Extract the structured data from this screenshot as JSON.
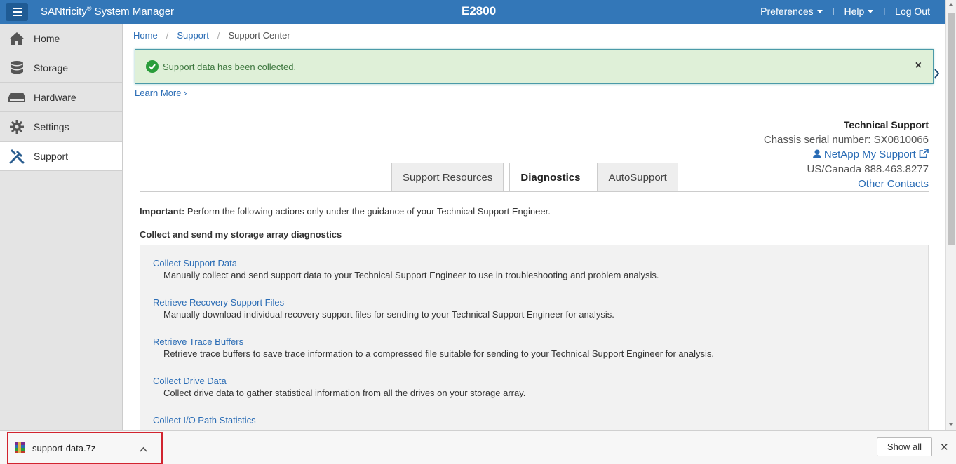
{
  "header": {
    "app_title_prefix": "SANtricity",
    "app_title_reg": "®",
    "app_title_suffix": " System Manager",
    "system_name": "E2800",
    "preferences": "Preferences",
    "help": "Help",
    "logout": "Log Out",
    "separator": "|"
  },
  "sidebar": {
    "items": [
      {
        "label": "Home",
        "icon": "home-icon"
      },
      {
        "label": "Storage",
        "icon": "database-icon"
      },
      {
        "label": "Hardware",
        "icon": "hardware-icon"
      },
      {
        "label": "Settings",
        "icon": "gear-icon"
      },
      {
        "label": "Support",
        "icon": "tools-icon",
        "active": true
      }
    ]
  },
  "breadcrumb": [
    "Home",
    "Support",
    "Support Center"
  ],
  "breadcrumb_sep": "/",
  "alert": {
    "message": "Support data has been collected.",
    "close": "×",
    "status_color": "#2a9d3b"
  },
  "learn_more": "Learn More ›",
  "tech_support": {
    "title": "Technical Support",
    "serial": "Chassis serial number: SX0810066",
    "my_support": "NetApp My Support",
    "phone": "US/Canada 888.463.8277",
    "other_contacts": "Other Contacts"
  },
  "tabs": [
    "Support Resources",
    "Diagnostics",
    "AutoSupport"
  ],
  "active_tab": "Diagnostics",
  "important_label": "Important:",
  "important_text": " Perform the following actions only under the guidance of your Technical Support Engineer.",
  "section_title": "Collect and send my storage array diagnostics",
  "actions": [
    {
      "title": "Collect Support Data",
      "desc": "Manually collect and send support data to your Technical Support Engineer to use in troubleshooting and problem analysis."
    },
    {
      "title": "Retrieve Recovery Support Files",
      "desc": "Manually download individual recovery support files for sending to your Technical Support Engineer for analysis."
    },
    {
      "title": "Retrieve Trace Buffers",
      "desc": "Retrieve trace buffers to save trace information to a compressed file suitable for sending to your Technical Support Engineer for analysis."
    },
    {
      "title": "Collect Drive Data",
      "desc": "Collect drive data to gather statistical information from all the drives on your storage array."
    },
    {
      "title": "Collect I/O Path Statistics",
      "desc": ""
    }
  ],
  "download_bar": {
    "filename": "support-data.7z",
    "show_all": "Show all",
    "close": "✕"
  },
  "colors": {
    "header_bg": "#3377b8",
    "link": "#2a6cb5",
    "alert_bg": "#dff0d8",
    "highlight_border": "#d1242f"
  }
}
